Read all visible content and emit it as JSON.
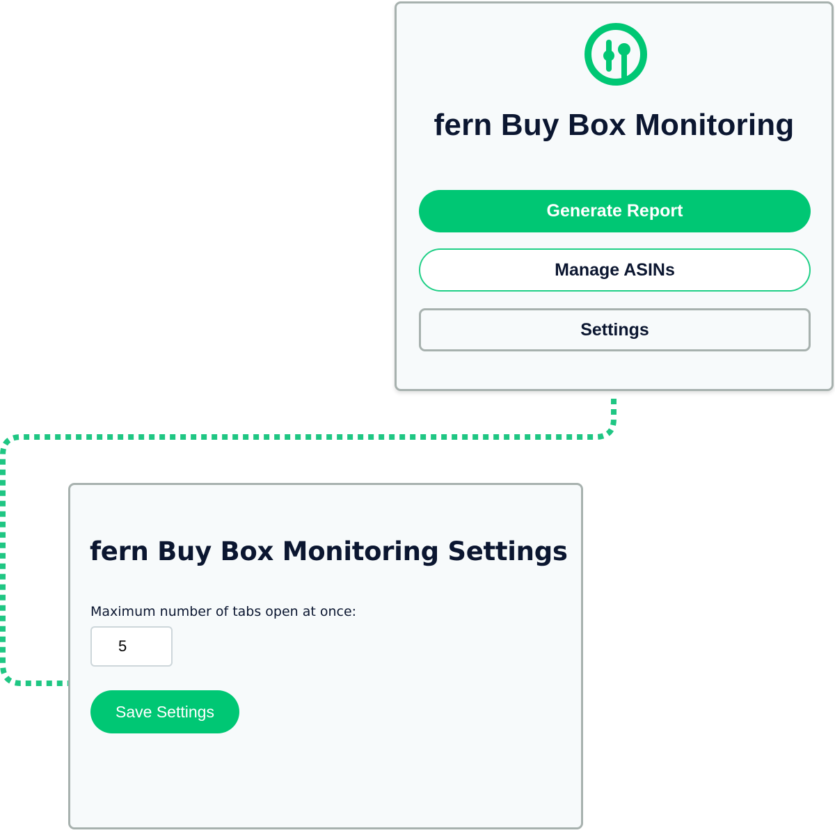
{
  "colors": {
    "accent": "#00c774",
    "outline_green": "#1fcf86",
    "title_text": "#0b1630",
    "panel_background": "#f7fafb",
    "panel_border": "#a7b1ae"
  },
  "popup": {
    "logo_icon": "fern-logo-icon",
    "title": "fern Buy Box Monitoring",
    "buttons": {
      "generate_report": "Generate Report",
      "manage_asins": "Manage ASINs",
      "settings": "Settings"
    }
  },
  "settings_page": {
    "title": "fern Buy Box Monitoring Settings",
    "max_tabs_label": "Maximum number of tabs open at once:",
    "max_tabs_value": "5",
    "save_button": "Save Settings"
  }
}
